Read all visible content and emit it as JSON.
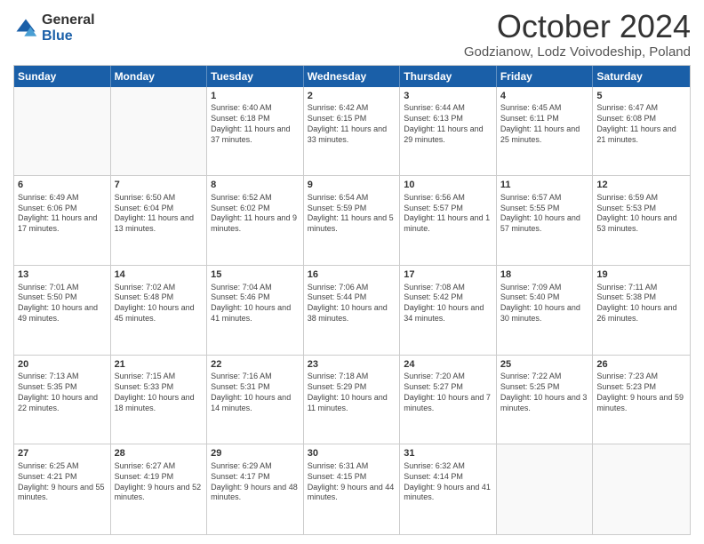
{
  "header": {
    "logo": {
      "general": "General",
      "blue": "Blue"
    },
    "title": "October 2024",
    "location": "Godzianow, Lodz Voivodeship, Poland"
  },
  "days": [
    "Sunday",
    "Monday",
    "Tuesday",
    "Wednesday",
    "Thursday",
    "Friday",
    "Saturday"
  ],
  "weeks": [
    [
      {
        "date": "",
        "sunrise": "",
        "sunset": "",
        "daylight": ""
      },
      {
        "date": "",
        "sunrise": "",
        "sunset": "",
        "daylight": ""
      },
      {
        "date": "1",
        "sunrise": "Sunrise: 6:40 AM",
        "sunset": "Sunset: 6:18 PM",
        "daylight": "Daylight: 11 hours and 37 minutes."
      },
      {
        "date": "2",
        "sunrise": "Sunrise: 6:42 AM",
        "sunset": "Sunset: 6:15 PM",
        "daylight": "Daylight: 11 hours and 33 minutes."
      },
      {
        "date": "3",
        "sunrise": "Sunrise: 6:44 AM",
        "sunset": "Sunset: 6:13 PM",
        "daylight": "Daylight: 11 hours and 29 minutes."
      },
      {
        "date": "4",
        "sunrise": "Sunrise: 6:45 AM",
        "sunset": "Sunset: 6:11 PM",
        "daylight": "Daylight: 11 hours and 25 minutes."
      },
      {
        "date": "5",
        "sunrise": "Sunrise: 6:47 AM",
        "sunset": "Sunset: 6:08 PM",
        "daylight": "Daylight: 11 hours and 21 minutes."
      }
    ],
    [
      {
        "date": "6",
        "sunrise": "Sunrise: 6:49 AM",
        "sunset": "Sunset: 6:06 PM",
        "daylight": "Daylight: 11 hours and 17 minutes."
      },
      {
        "date": "7",
        "sunrise": "Sunrise: 6:50 AM",
        "sunset": "Sunset: 6:04 PM",
        "daylight": "Daylight: 11 hours and 13 minutes."
      },
      {
        "date": "8",
        "sunrise": "Sunrise: 6:52 AM",
        "sunset": "Sunset: 6:02 PM",
        "daylight": "Daylight: 11 hours and 9 minutes."
      },
      {
        "date": "9",
        "sunrise": "Sunrise: 6:54 AM",
        "sunset": "Sunset: 5:59 PM",
        "daylight": "Daylight: 11 hours and 5 minutes."
      },
      {
        "date": "10",
        "sunrise": "Sunrise: 6:56 AM",
        "sunset": "Sunset: 5:57 PM",
        "daylight": "Daylight: 11 hours and 1 minute."
      },
      {
        "date": "11",
        "sunrise": "Sunrise: 6:57 AM",
        "sunset": "Sunset: 5:55 PM",
        "daylight": "Daylight: 10 hours and 57 minutes."
      },
      {
        "date": "12",
        "sunrise": "Sunrise: 6:59 AM",
        "sunset": "Sunset: 5:53 PM",
        "daylight": "Daylight: 10 hours and 53 minutes."
      }
    ],
    [
      {
        "date": "13",
        "sunrise": "Sunrise: 7:01 AM",
        "sunset": "Sunset: 5:50 PM",
        "daylight": "Daylight: 10 hours and 49 minutes."
      },
      {
        "date": "14",
        "sunrise": "Sunrise: 7:02 AM",
        "sunset": "Sunset: 5:48 PM",
        "daylight": "Daylight: 10 hours and 45 minutes."
      },
      {
        "date": "15",
        "sunrise": "Sunrise: 7:04 AM",
        "sunset": "Sunset: 5:46 PM",
        "daylight": "Daylight: 10 hours and 41 minutes."
      },
      {
        "date": "16",
        "sunrise": "Sunrise: 7:06 AM",
        "sunset": "Sunset: 5:44 PM",
        "daylight": "Daylight: 10 hours and 38 minutes."
      },
      {
        "date": "17",
        "sunrise": "Sunrise: 7:08 AM",
        "sunset": "Sunset: 5:42 PM",
        "daylight": "Daylight: 10 hours and 34 minutes."
      },
      {
        "date": "18",
        "sunrise": "Sunrise: 7:09 AM",
        "sunset": "Sunset: 5:40 PM",
        "daylight": "Daylight: 10 hours and 30 minutes."
      },
      {
        "date": "19",
        "sunrise": "Sunrise: 7:11 AM",
        "sunset": "Sunset: 5:38 PM",
        "daylight": "Daylight: 10 hours and 26 minutes."
      }
    ],
    [
      {
        "date": "20",
        "sunrise": "Sunrise: 7:13 AM",
        "sunset": "Sunset: 5:35 PM",
        "daylight": "Daylight: 10 hours and 22 minutes."
      },
      {
        "date": "21",
        "sunrise": "Sunrise: 7:15 AM",
        "sunset": "Sunset: 5:33 PM",
        "daylight": "Daylight: 10 hours and 18 minutes."
      },
      {
        "date": "22",
        "sunrise": "Sunrise: 7:16 AM",
        "sunset": "Sunset: 5:31 PM",
        "daylight": "Daylight: 10 hours and 14 minutes."
      },
      {
        "date": "23",
        "sunrise": "Sunrise: 7:18 AM",
        "sunset": "Sunset: 5:29 PM",
        "daylight": "Daylight: 10 hours and 11 minutes."
      },
      {
        "date": "24",
        "sunrise": "Sunrise: 7:20 AM",
        "sunset": "Sunset: 5:27 PM",
        "daylight": "Daylight: 10 hours and 7 minutes."
      },
      {
        "date": "25",
        "sunrise": "Sunrise: 7:22 AM",
        "sunset": "Sunset: 5:25 PM",
        "daylight": "Daylight: 10 hours and 3 minutes."
      },
      {
        "date": "26",
        "sunrise": "Sunrise: 7:23 AM",
        "sunset": "Sunset: 5:23 PM",
        "daylight": "Daylight: 9 hours and 59 minutes."
      }
    ],
    [
      {
        "date": "27",
        "sunrise": "Sunrise: 6:25 AM",
        "sunset": "Sunset: 4:21 PM",
        "daylight": "Daylight: 9 hours and 55 minutes."
      },
      {
        "date": "28",
        "sunrise": "Sunrise: 6:27 AM",
        "sunset": "Sunset: 4:19 PM",
        "daylight": "Daylight: 9 hours and 52 minutes."
      },
      {
        "date": "29",
        "sunrise": "Sunrise: 6:29 AM",
        "sunset": "Sunset: 4:17 PM",
        "daylight": "Daylight: 9 hours and 48 minutes."
      },
      {
        "date": "30",
        "sunrise": "Sunrise: 6:31 AM",
        "sunset": "Sunset: 4:15 PM",
        "daylight": "Daylight: 9 hours and 44 minutes."
      },
      {
        "date": "31",
        "sunrise": "Sunrise: 6:32 AM",
        "sunset": "Sunset: 4:14 PM",
        "daylight": "Daylight: 9 hours and 41 minutes."
      },
      {
        "date": "",
        "sunrise": "",
        "sunset": "",
        "daylight": ""
      },
      {
        "date": "",
        "sunrise": "",
        "sunset": "",
        "daylight": ""
      }
    ]
  ]
}
